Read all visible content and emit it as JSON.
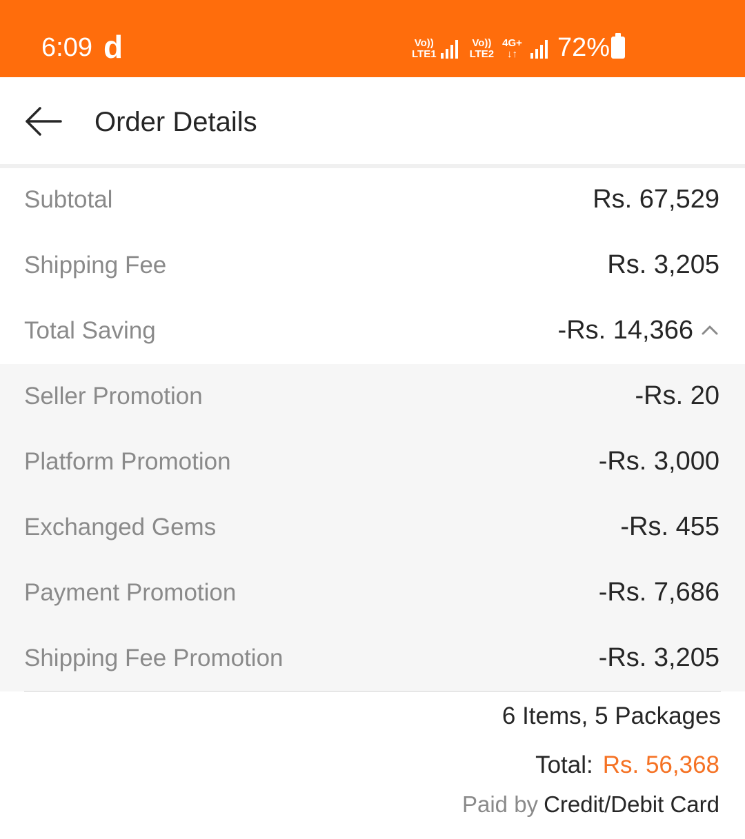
{
  "status_bar": {
    "time": "6:09",
    "app_letter": "d",
    "sim1_top": "Vo))",
    "sim1_bottom": "LTE1",
    "sim2_top": "Vo))",
    "sim2_bottom": "LTE2",
    "network_type": "4G+",
    "battery": "72%"
  },
  "header": {
    "title": "Order Details",
    "back_icon": "arrow-left-icon"
  },
  "summary_rows": [
    {
      "label": "Subtotal",
      "value": "Rs. 67,529"
    },
    {
      "label": "Shipping Fee",
      "value": "Rs. 3,205"
    },
    {
      "label": "Total Saving",
      "value": "-Rs. 14,366",
      "icon": "chevron-up-icon"
    }
  ],
  "saving_breakdown": [
    {
      "label": "Seller Promotion",
      "value": "-Rs. 20"
    },
    {
      "label": "Platform Promotion",
      "value": "-Rs. 3,000"
    },
    {
      "label": "Exchanged Gems",
      "value": "-Rs. 455"
    },
    {
      "label": "Payment Promotion",
      "value": "-Rs. 7,686"
    },
    {
      "label": "Shipping Fee Promotion",
      "value": "-Rs. 3,205"
    }
  ],
  "footer": {
    "items_count": "6 Items, 5 Packages",
    "total_label": "Total:",
    "total_value": "Rs. 56,368",
    "paid_by_label": "Paid by",
    "paid_by_method": "Credit/Debit Card"
  },
  "colors": {
    "status_bar": "#ff6d0c",
    "accent": "#f57224",
    "shaded_row": "#f6f6f6"
  }
}
